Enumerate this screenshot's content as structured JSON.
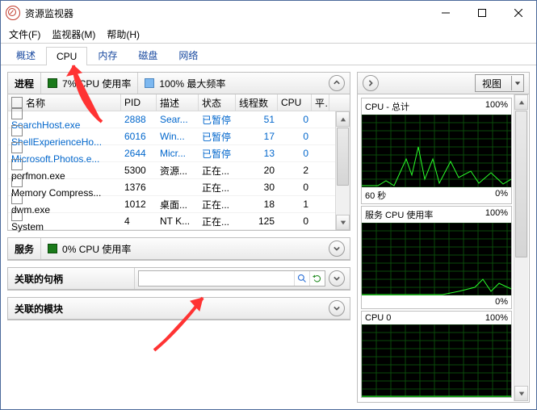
{
  "window_title": "资源监视器",
  "menu": {
    "file": "文件(F)",
    "monitor": "监视器(M)",
    "help": "帮助(H)"
  },
  "tabs": [
    "概述",
    "CPU",
    "内存",
    "磁盘",
    "网络"
  ],
  "active_tab": 1,
  "process_panel": {
    "title": "进程",
    "meter1": "7% CPU 使用率",
    "meter2": "100% 最大频率",
    "columns": {
      "name": "名称",
      "pid": "PID",
      "desc": "描述",
      "status": "状态",
      "threads": "线程数",
      "cpu": "CPU",
      "avg": "平…"
    },
    "rows": [
      {
        "name": "SearchHost.exe",
        "pid": "2888",
        "desc": "Sear...",
        "status": "已暂停",
        "threads": "51",
        "cpu": "0",
        "blue": true
      },
      {
        "name": "ShellExperienceHo...",
        "pid": "6016",
        "desc": "Win...",
        "status": "已暂停",
        "threads": "17",
        "cpu": "0",
        "blue": true
      },
      {
        "name": "Microsoft.Photos.e...",
        "pid": "2644",
        "desc": "Micr...",
        "status": "已暂停",
        "threads": "13",
        "cpu": "0",
        "blue": true
      },
      {
        "name": "perfmon.exe",
        "pid": "5300",
        "desc": "资源...",
        "status": "正在...",
        "threads": "20",
        "cpu": "2",
        "blue": false
      },
      {
        "name": "Memory Compress...",
        "pid": "1376",
        "desc": "",
        "status": "正在...",
        "threads": "30",
        "cpu": "0",
        "blue": false
      },
      {
        "name": "dwm.exe",
        "pid": "1012",
        "desc": "桌面...",
        "status": "正在...",
        "threads": "18",
        "cpu": "1",
        "blue": false
      },
      {
        "name": "System",
        "pid": "4",
        "desc": "NT K...",
        "status": "正在...",
        "threads": "125",
        "cpu": "0",
        "blue": false
      }
    ]
  },
  "services_panel": {
    "title": "服务",
    "meter": "0% CPU 使用率"
  },
  "handles_panel": {
    "title": "关联的句柄",
    "placeholder": ""
  },
  "modules_panel": {
    "title": "关联的模块"
  },
  "right": {
    "view_label": "视图",
    "charts": [
      {
        "title": "CPU - 总计",
        "right": "100%",
        "footer_left": "60 秒",
        "footer_right": "0%"
      },
      {
        "title": "服务 CPU 使用率",
        "right": "100%",
        "footer_left": "",
        "footer_right": "0%"
      },
      {
        "title": "CPU 0",
        "right": "100%",
        "footer_left": "",
        "footer_right": ""
      }
    ]
  }
}
